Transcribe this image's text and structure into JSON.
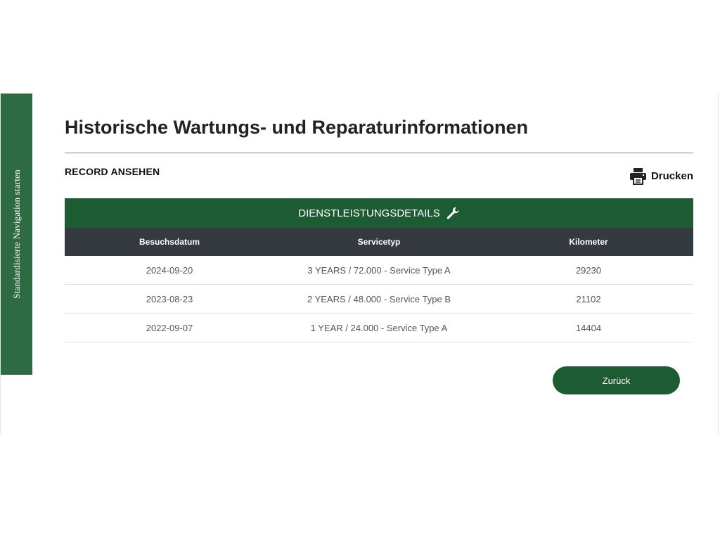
{
  "side_nav": {
    "label": "Standardisierte Navigation starten"
  },
  "page": {
    "title": "Historische Wartungs- und Reparaturinformationen",
    "section_heading": "RECORD ANSEHEN"
  },
  "toolbar": {
    "print_label": "Drucken",
    "print_icon": "printer-icon"
  },
  "table": {
    "banner_title": "DIENSTLEISTUNGSDETAILS",
    "banner_icon": "wrench-icon",
    "columns": [
      "Besuchsdatum",
      "Servicetyp",
      "Kilometer"
    ],
    "rows": [
      {
        "date": "2024-09-20",
        "service_type": "3 YEARS / 72.000 - Service Type A",
        "km": "29230"
      },
      {
        "date": "2023-08-23",
        "service_type": "2 YEARS / 48.000 - Service Type B",
        "km": "21102"
      },
      {
        "date": "2022-09-07",
        "service_type": "1 YEAR / 24.000 - Service Type A",
        "km": "14404"
      }
    ]
  },
  "actions": {
    "back_label": "Zurück"
  },
  "colors": {
    "brand_green": "#1d5c33",
    "nav_green": "#2e6b42",
    "table_header_dark": "#343a40"
  }
}
